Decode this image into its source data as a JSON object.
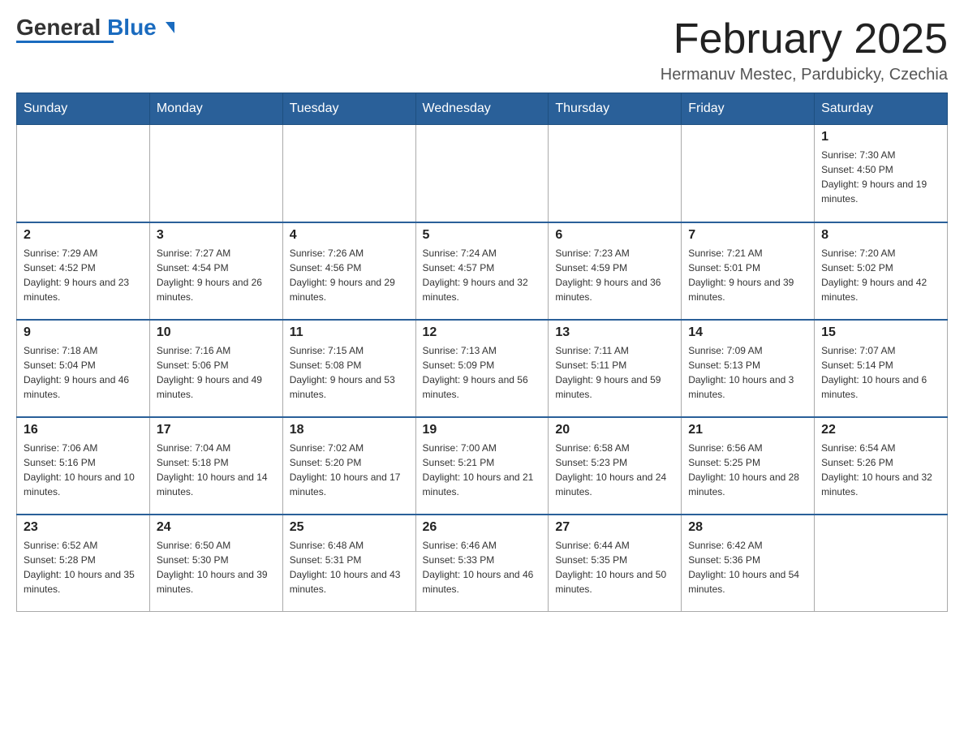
{
  "header": {
    "logo_text_black": "General",
    "logo_text_blue": "Blue",
    "month_title": "February 2025",
    "location": "Hermanuv Mestec, Pardubicky, Czechia"
  },
  "weekdays": [
    "Sunday",
    "Monday",
    "Tuesday",
    "Wednesday",
    "Thursday",
    "Friday",
    "Saturday"
  ],
  "weeks": [
    [
      {
        "day": "",
        "sunrise": "",
        "sunset": "",
        "daylight": ""
      },
      {
        "day": "",
        "sunrise": "",
        "sunset": "",
        "daylight": ""
      },
      {
        "day": "",
        "sunrise": "",
        "sunset": "",
        "daylight": ""
      },
      {
        "day": "",
        "sunrise": "",
        "sunset": "",
        "daylight": ""
      },
      {
        "day": "",
        "sunrise": "",
        "sunset": "",
        "daylight": ""
      },
      {
        "day": "",
        "sunrise": "",
        "sunset": "",
        "daylight": ""
      },
      {
        "day": "1",
        "sunrise": "Sunrise: 7:30 AM",
        "sunset": "Sunset: 4:50 PM",
        "daylight": "Daylight: 9 hours and 19 minutes."
      }
    ],
    [
      {
        "day": "2",
        "sunrise": "Sunrise: 7:29 AM",
        "sunset": "Sunset: 4:52 PM",
        "daylight": "Daylight: 9 hours and 23 minutes."
      },
      {
        "day": "3",
        "sunrise": "Sunrise: 7:27 AM",
        "sunset": "Sunset: 4:54 PM",
        "daylight": "Daylight: 9 hours and 26 minutes."
      },
      {
        "day": "4",
        "sunrise": "Sunrise: 7:26 AM",
        "sunset": "Sunset: 4:56 PM",
        "daylight": "Daylight: 9 hours and 29 minutes."
      },
      {
        "day": "5",
        "sunrise": "Sunrise: 7:24 AM",
        "sunset": "Sunset: 4:57 PM",
        "daylight": "Daylight: 9 hours and 32 minutes."
      },
      {
        "day": "6",
        "sunrise": "Sunrise: 7:23 AM",
        "sunset": "Sunset: 4:59 PM",
        "daylight": "Daylight: 9 hours and 36 minutes."
      },
      {
        "day": "7",
        "sunrise": "Sunrise: 7:21 AM",
        "sunset": "Sunset: 5:01 PM",
        "daylight": "Daylight: 9 hours and 39 minutes."
      },
      {
        "day": "8",
        "sunrise": "Sunrise: 7:20 AM",
        "sunset": "Sunset: 5:02 PM",
        "daylight": "Daylight: 9 hours and 42 minutes."
      }
    ],
    [
      {
        "day": "9",
        "sunrise": "Sunrise: 7:18 AM",
        "sunset": "Sunset: 5:04 PM",
        "daylight": "Daylight: 9 hours and 46 minutes."
      },
      {
        "day": "10",
        "sunrise": "Sunrise: 7:16 AM",
        "sunset": "Sunset: 5:06 PM",
        "daylight": "Daylight: 9 hours and 49 minutes."
      },
      {
        "day": "11",
        "sunrise": "Sunrise: 7:15 AM",
        "sunset": "Sunset: 5:08 PM",
        "daylight": "Daylight: 9 hours and 53 minutes."
      },
      {
        "day": "12",
        "sunrise": "Sunrise: 7:13 AM",
        "sunset": "Sunset: 5:09 PM",
        "daylight": "Daylight: 9 hours and 56 minutes."
      },
      {
        "day": "13",
        "sunrise": "Sunrise: 7:11 AM",
        "sunset": "Sunset: 5:11 PM",
        "daylight": "Daylight: 9 hours and 59 minutes."
      },
      {
        "day": "14",
        "sunrise": "Sunrise: 7:09 AM",
        "sunset": "Sunset: 5:13 PM",
        "daylight": "Daylight: 10 hours and 3 minutes."
      },
      {
        "day": "15",
        "sunrise": "Sunrise: 7:07 AM",
        "sunset": "Sunset: 5:14 PM",
        "daylight": "Daylight: 10 hours and 6 minutes."
      }
    ],
    [
      {
        "day": "16",
        "sunrise": "Sunrise: 7:06 AM",
        "sunset": "Sunset: 5:16 PM",
        "daylight": "Daylight: 10 hours and 10 minutes."
      },
      {
        "day": "17",
        "sunrise": "Sunrise: 7:04 AM",
        "sunset": "Sunset: 5:18 PM",
        "daylight": "Daylight: 10 hours and 14 minutes."
      },
      {
        "day": "18",
        "sunrise": "Sunrise: 7:02 AM",
        "sunset": "Sunset: 5:20 PM",
        "daylight": "Daylight: 10 hours and 17 minutes."
      },
      {
        "day": "19",
        "sunrise": "Sunrise: 7:00 AM",
        "sunset": "Sunset: 5:21 PM",
        "daylight": "Daylight: 10 hours and 21 minutes."
      },
      {
        "day": "20",
        "sunrise": "Sunrise: 6:58 AM",
        "sunset": "Sunset: 5:23 PM",
        "daylight": "Daylight: 10 hours and 24 minutes."
      },
      {
        "day": "21",
        "sunrise": "Sunrise: 6:56 AM",
        "sunset": "Sunset: 5:25 PM",
        "daylight": "Daylight: 10 hours and 28 minutes."
      },
      {
        "day": "22",
        "sunrise": "Sunrise: 6:54 AM",
        "sunset": "Sunset: 5:26 PM",
        "daylight": "Daylight: 10 hours and 32 minutes."
      }
    ],
    [
      {
        "day": "23",
        "sunrise": "Sunrise: 6:52 AM",
        "sunset": "Sunset: 5:28 PM",
        "daylight": "Daylight: 10 hours and 35 minutes."
      },
      {
        "day": "24",
        "sunrise": "Sunrise: 6:50 AM",
        "sunset": "Sunset: 5:30 PM",
        "daylight": "Daylight: 10 hours and 39 minutes."
      },
      {
        "day": "25",
        "sunrise": "Sunrise: 6:48 AM",
        "sunset": "Sunset: 5:31 PM",
        "daylight": "Daylight: 10 hours and 43 minutes."
      },
      {
        "day": "26",
        "sunrise": "Sunrise: 6:46 AM",
        "sunset": "Sunset: 5:33 PM",
        "daylight": "Daylight: 10 hours and 46 minutes."
      },
      {
        "day": "27",
        "sunrise": "Sunrise: 6:44 AM",
        "sunset": "Sunset: 5:35 PM",
        "daylight": "Daylight: 10 hours and 50 minutes."
      },
      {
        "day": "28",
        "sunrise": "Sunrise: 6:42 AM",
        "sunset": "Sunset: 5:36 PM",
        "daylight": "Daylight: 10 hours and 54 minutes."
      },
      {
        "day": "",
        "sunrise": "",
        "sunset": "",
        "daylight": ""
      }
    ]
  ]
}
